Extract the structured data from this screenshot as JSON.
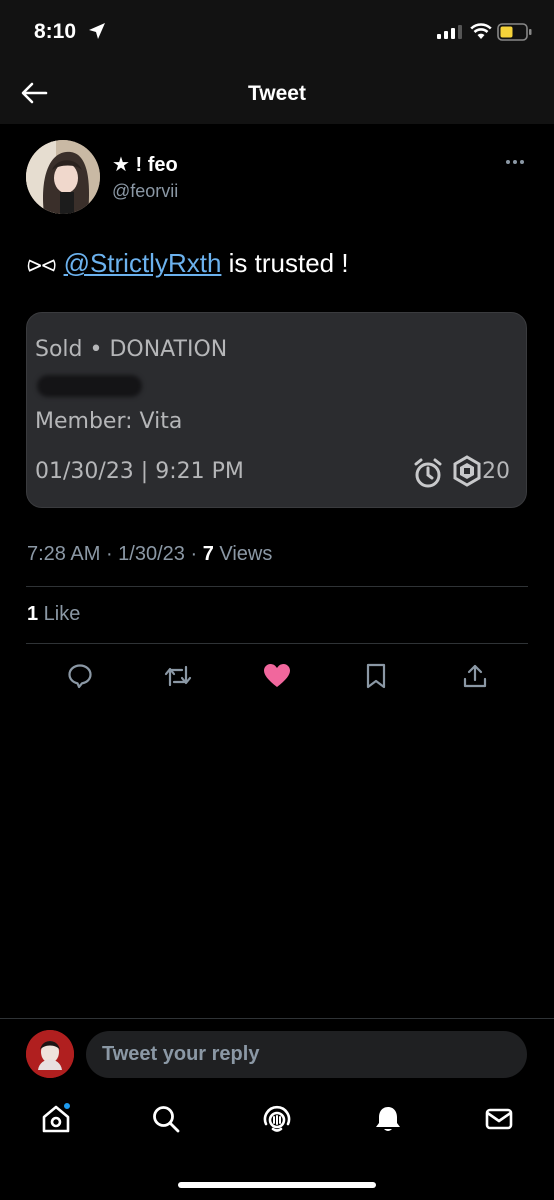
{
  "status_bar": {
    "time": "8:10"
  },
  "nav": {
    "title": "Tweet"
  },
  "tweet": {
    "author_name": "★ ! feo",
    "author_handle": "@feorvii",
    "text_prefix": "⪧⪦ ",
    "mention": "@StrictlyRxth",
    "text_suffix": " is trusted !",
    "card": {
      "line1": "Sold • DONATION",
      "line2": "Member: Vita",
      "date": "01/30/23 | 9:21 PM",
      "robux": "20"
    },
    "meta": {
      "time": "7:28 AM",
      "sep1": " · ",
      "date": "1/30/23",
      "sep2": " · ",
      "views_count": "7",
      "views_label": " Views"
    },
    "likes": {
      "count": "1",
      "label": " Like"
    }
  },
  "reply": {
    "placeholder": "Tweet your reply"
  },
  "colors": {
    "background": "#000000",
    "mention": "#6cb2ee",
    "like": "#f1679d",
    "card": "#2b2c2f"
  },
  "icons": {
    "actions": [
      "reply-icon",
      "retweet-icon",
      "like-icon",
      "bookmark-icon",
      "share-icon"
    ],
    "tabs": [
      "home-icon",
      "search-icon",
      "spaces-icon",
      "notifications-icon",
      "messages-icon"
    ]
  }
}
